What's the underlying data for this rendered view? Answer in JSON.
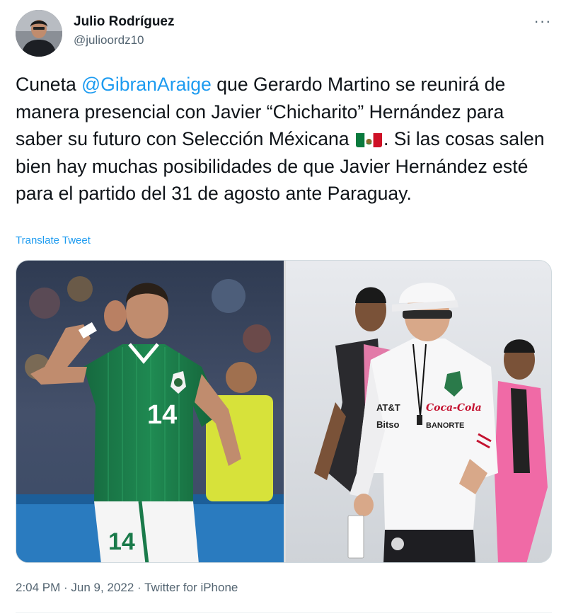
{
  "author": {
    "name": "Julio Rodríguez",
    "handle": "@julioordz10"
  },
  "more_label": "···",
  "tweet": {
    "text_prefix": "Cuneta ",
    "mention": "@GibranAraige",
    "text_main": " que Gerardo Martino se reunirá de manera presencial con Javier “Chicharito” Hernández para saber su futuro con Selección Méxicana ",
    "text_suffix": ". Si las cosas salen bien hay muchas posibilidades de que Javier Hernández esté para el partido del 31 de agosto ante Paraguay."
  },
  "translate_label": "Translate Tweet",
  "photos": {
    "left_jersey_number": "14",
    "left_shorts_number": "14",
    "right_sponsors": [
      "AT&T",
      "Coca-Cola",
      "Bitso",
      "BANORTE"
    ]
  },
  "meta": {
    "time": "2:04 PM",
    "separator": " · ",
    "date": "Jun 9, 2022",
    "source": "Twitter for iPhone"
  },
  "colors": {
    "link": "#1d9bf0",
    "text": "#0f1419",
    "secondary": "#536471",
    "jersey_green": "#1e7a4a"
  }
}
